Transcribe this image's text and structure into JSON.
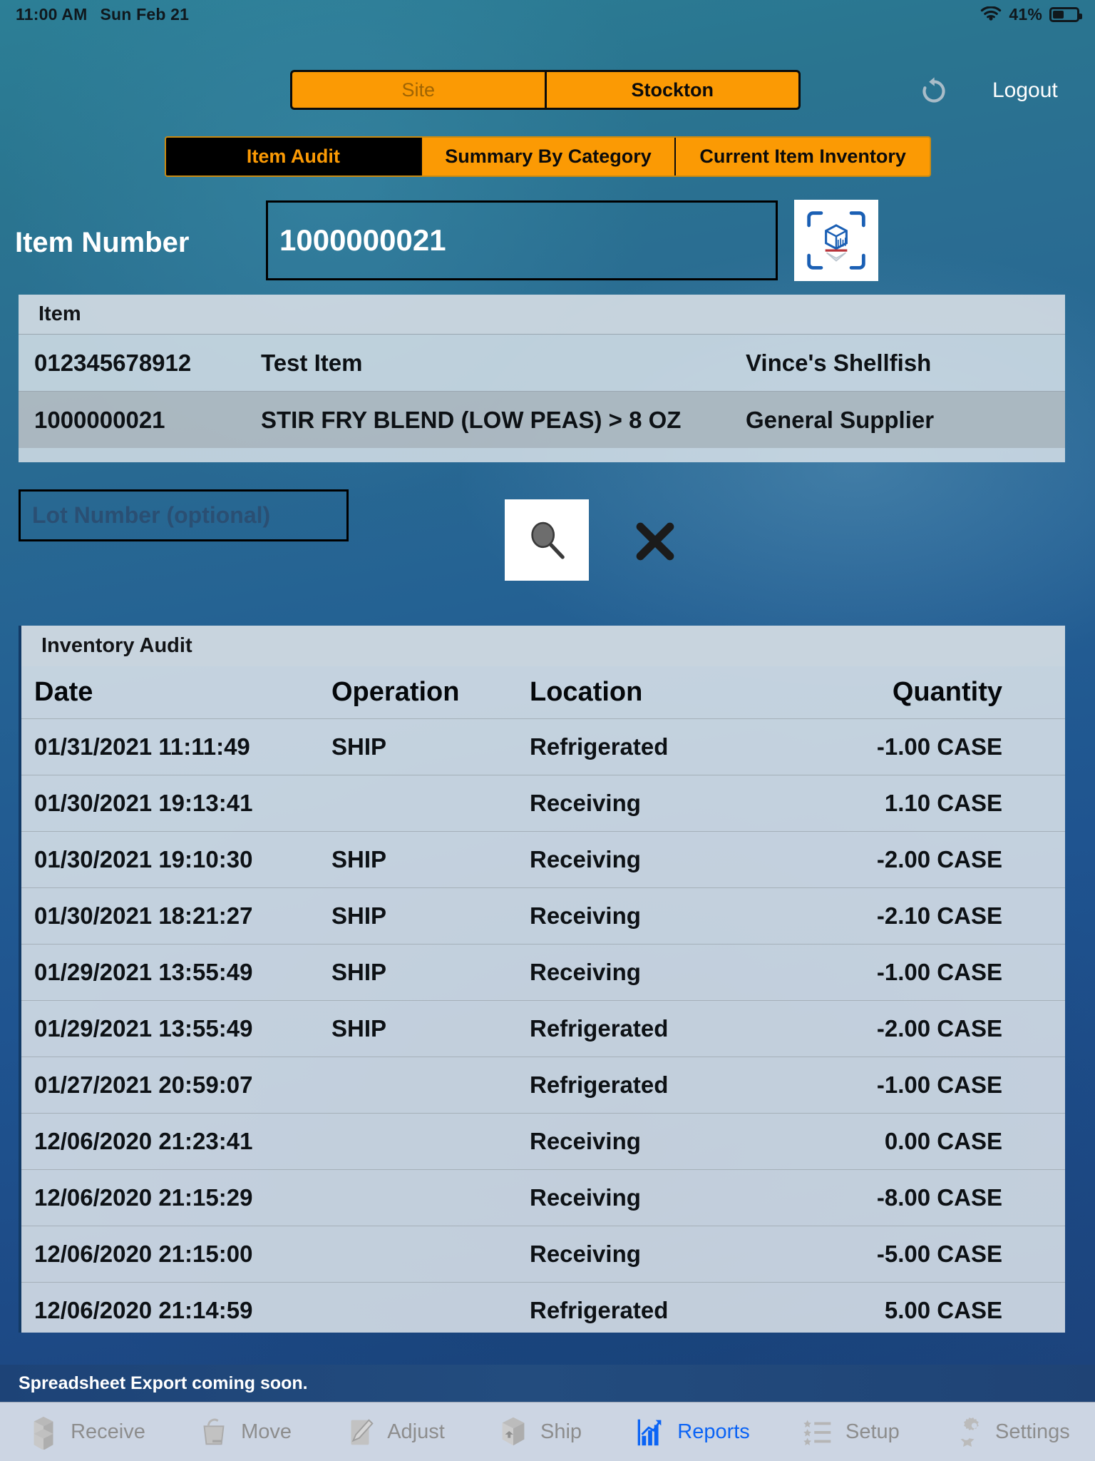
{
  "status_bar": {
    "time": "11:00 AM",
    "date": "Sun Feb 21",
    "wifi_icon": "wifi-icon",
    "battery_percent": "41%",
    "battery_icon": "battery-icon",
    "battery_level": 41
  },
  "header": {
    "site_selector": {
      "label_placeholder": "Site",
      "selected_value": "Stockton"
    },
    "refresh_icon": "refresh-icon",
    "logout_label": "Logout"
  },
  "report_tabs": [
    {
      "label": "Item Audit",
      "active": true
    },
    {
      "label": "Summary By Category",
      "active": false
    },
    {
      "label": "Current Item Inventory",
      "active": false
    }
  ],
  "item_lookup": {
    "label": "Item Number",
    "value": "1000000021",
    "placeholder": "Item Number",
    "scan_icon": "barcode-scan-icon"
  },
  "item_table": {
    "title": "Item",
    "rows": [
      {
        "number": "012345678912",
        "description": "Test Item",
        "supplier": "Vince's Shellfish",
        "selected": false
      },
      {
        "number": "1000000021",
        "description": "STIR FRY BLEND (LOW PEAS) > 8 OZ",
        "supplier": "General Supplier",
        "selected": true
      }
    ]
  },
  "lot_field": {
    "value": "",
    "placeholder": "Lot Number (optional)"
  },
  "actions": {
    "search_icon": "magnifier-icon",
    "clear_icon": "close-x-icon"
  },
  "inventory_audit": {
    "title": "Inventory Audit",
    "columns": [
      "Date",
      "Operation",
      "Location",
      "Quantity"
    ],
    "rows": [
      {
        "date": "01/31/2021 11:11:49",
        "operation": "SHIP",
        "location": "Refrigerated",
        "quantity": "-1.00 CASE"
      },
      {
        "date": "01/30/2021 19:13:41",
        "operation": "",
        "location": "Receiving",
        "quantity": "1.10 CASE"
      },
      {
        "date": "01/30/2021 19:10:30",
        "operation": "SHIP",
        "location": "Receiving",
        "quantity": "-2.00 CASE"
      },
      {
        "date": "01/30/2021 18:21:27",
        "operation": "SHIP",
        "location": "Receiving",
        "quantity": "-2.10 CASE"
      },
      {
        "date": "01/29/2021 13:55:49",
        "operation": "SHIP",
        "location": "Receiving",
        "quantity": "-1.00 CASE"
      },
      {
        "date": "01/29/2021 13:55:49",
        "operation": "SHIP",
        "location": "Refrigerated",
        "quantity": "-2.00 CASE"
      },
      {
        "date": "01/27/2021 20:59:07",
        "operation": "",
        "location": "Refrigerated",
        "quantity": "-1.00 CASE"
      },
      {
        "date": "12/06/2020 21:23:41",
        "operation": "",
        "location": "Receiving",
        "quantity": "0.00 CASE"
      },
      {
        "date": "12/06/2020 21:15:29",
        "operation": "",
        "location": "Receiving",
        "quantity": "-8.00 CASE"
      },
      {
        "date": "12/06/2020 21:15:00",
        "operation": "",
        "location": "Receiving",
        "quantity": "-5.00 CASE"
      },
      {
        "date": "12/06/2020 21:14:59",
        "operation": "",
        "location": "Refrigerated",
        "quantity": "5.00 CASE"
      }
    ]
  },
  "footer_note": "Spreadsheet Export coming soon.",
  "tab_bar": [
    {
      "label": "Receive",
      "icon": "open-box-icon",
      "active": false
    },
    {
      "label": "Move",
      "icon": "basket-icon",
      "active": false
    },
    {
      "label": "Adjust",
      "icon": "pencil-form-icon",
      "active": false
    },
    {
      "label": "Ship",
      "icon": "closed-box-icon",
      "active": false
    },
    {
      "label": "Reports",
      "icon": "bar-chart-icon",
      "active": true
    },
    {
      "label": "Setup",
      "icon": "star-list-icon",
      "active": false
    },
    {
      "label": "Settings",
      "icon": "gears-icon",
      "active": false
    }
  ],
  "colors": {
    "accent_orange": "#fb9a04",
    "active_tab_bg": "#000000",
    "active_tab_text": "#fb9a04",
    "bg_blue_top": "#2c7f96",
    "bg_blue_bottom": "#1b4078",
    "panel_bg": "#dee5eb",
    "selected_row_bg": "#a8b5be",
    "footer_bar_bg": "#1d4377",
    "tabbar_bg": "#ccd5e3",
    "tabbar_active": "#0a63f5",
    "tabbar_inactive": "#8d8d8d"
  }
}
